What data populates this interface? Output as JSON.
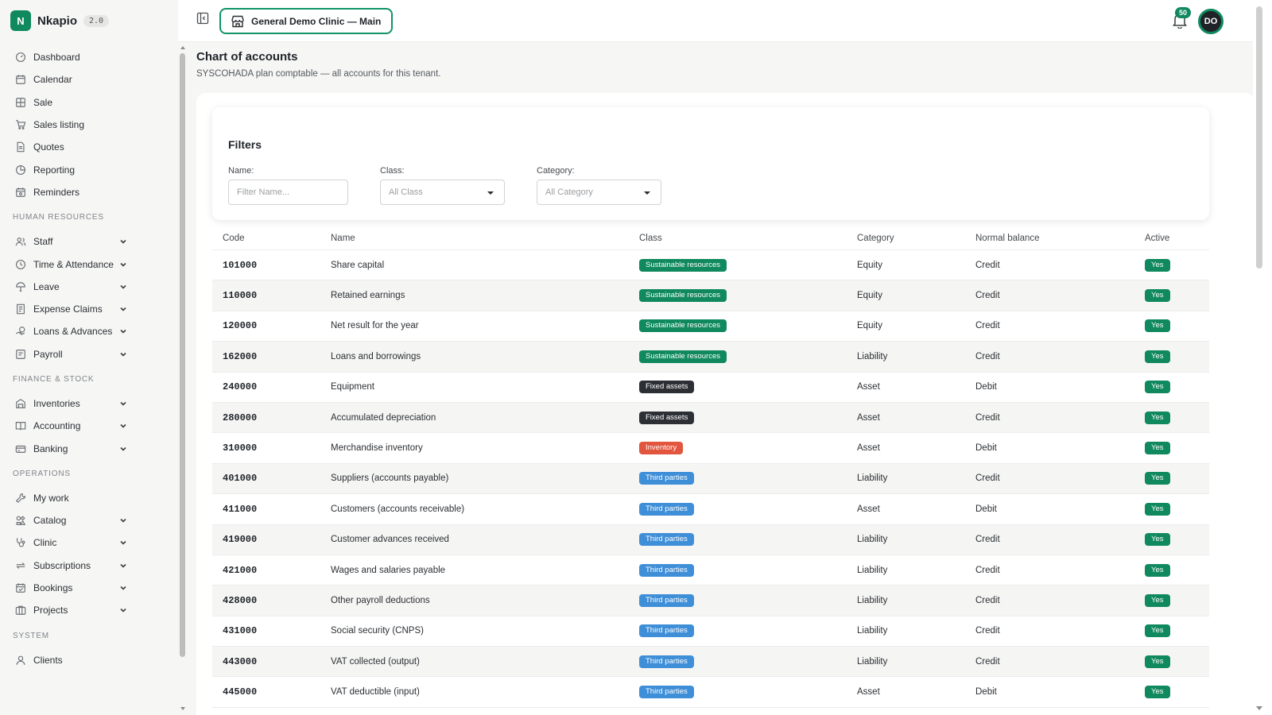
{
  "app": {
    "name": "Nkapio",
    "version": "2.0",
    "logo_letter": "N"
  },
  "topbar": {
    "clinic": "General Demo Clinic — Main",
    "notifications": "50",
    "avatar_initials": "DO"
  },
  "sidebar": {
    "main": [
      {
        "label": "Dashboard",
        "icon": "dashboard-icon"
      },
      {
        "label": "Calendar",
        "icon": "calendar-icon"
      },
      {
        "label": "Sale",
        "icon": "sale-icon"
      },
      {
        "label": "Sales listing",
        "icon": "cart-icon"
      },
      {
        "label": "Quotes",
        "icon": "quotes-icon"
      },
      {
        "label": "Reporting",
        "icon": "reporting-icon"
      },
      {
        "label": "Reminders",
        "icon": "reminders-icon"
      }
    ],
    "hr_title": "HUMAN RESOURCES",
    "hr": [
      {
        "label": "Staff",
        "icon": "staff-icon"
      },
      {
        "label": "Time & Attendance",
        "icon": "clock-icon"
      },
      {
        "label": "Leave",
        "icon": "leave-icon"
      },
      {
        "label": "Expense Claims",
        "icon": "expense-icon"
      },
      {
        "label": "Loans & Advances",
        "icon": "loans-icon"
      },
      {
        "label": "Payroll",
        "icon": "payroll-icon"
      }
    ],
    "finance_title": "FINANCE & STOCK",
    "finance": [
      {
        "label": "Inventories",
        "icon": "inventory-icon"
      },
      {
        "label": "Accounting",
        "icon": "book-icon"
      },
      {
        "label": "Banking",
        "icon": "bank-icon"
      }
    ],
    "ops_title": "OPERATIONS",
    "ops": [
      {
        "label": "My work",
        "icon": "wrench-icon"
      },
      {
        "label": "Catalog",
        "icon": "catalog-icon"
      },
      {
        "label": "Clinic",
        "icon": "stethoscope-icon"
      },
      {
        "label": "Subscriptions",
        "icon": "repeat-icon"
      },
      {
        "label": "Bookings",
        "icon": "bookings-icon"
      },
      {
        "label": "Projects",
        "icon": "projects-icon"
      }
    ],
    "system_title": "SYSTEM",
    "system": [
      {
        "label": "Clients",
        "icon": "user-icon"
      }
    ]
  },
  "page": {
    "title": "Chart of accounts",
    "subtitle": "SYSCOHADA plan comptable — all accounts for this tenant."
  },
  "filters": {
    "title": "Filters",
    "name_label": "Name:",
    "name_placeholder": "Filter Name...",
    "class_label": "Class:",
    "class_value": "All Class",
    "category_label": "Category:",
    "category_value": "All Category"
  },
  "table": {
    "columns": [
      "Code",
      "Name",
      "Class",
      "Category",
      "Normal balance",
      "Active"
    ],
    "rows": [
      {
        "code": "101000",
        "name": "Share capital",
        "class": "Sustainable resources",
        "class_color": "#10895f",
        "category": "Equity",
        "balance": "Credit",
        "active": "Yes"
      },
      {
        "code": "110000",
        "name": "Retained earnings",
        "class": "Sustainable resources",
        "class_color": "#10895f",
        "category": "Equity",
        "balance": "Credit",
        "active": "Yes"
      },
      {
        "code": "120000",
        "name": "Net result for the year",
        "class": "Sustainable resources",
        "class_color": "#10895f",
        "category": "Equity",
        "balance": "Credit",
        "active": "Yes"
      },
      {
        "code": "162000",
        "name": "Loans and borrowings",
        "class": "Sustainable resources",
        "class_color": "#10895f",
        "category": "Liability",
        "balance": "Credit",
        "active": "Yes"
      },
      {
        "code": "240000",
        "name": "Equipment",
        "class": "Fixed assets",
        "class_color": "#2c3035",
        "category": "Asset",
        "balance": "Debit",
        "active": "Yes"
      },
      {
        "code": "280000",
        "name": "Accumulated depreciation",
        "class": "Fixed assets",
        "class_color": "#2c3035",
        "category": "Asset",
        "balance": "Credit",
        "active": "Yes"
      },
      {
        "code": "310000",
        "name": "Merchandise inventory",
        "class": "Inventory",
        "class_color": "#e2553e",
        "category": "Asset",
        "balance": "Debit",
        "active": "Yes"
      },
      {
        "code": "401000",
        "name": "Suppliers (accounts payable)",
        "class": "Third parties",
        "class_color": "#3f8fd8",
        "category": "Liability",
        "balance": "Credit",
        "active": "Yes"
      },
      {
        "code": "411000",
        "name": "Customers (accounts receivable)",
        "class": "Third parties",
        "class_color": "#3f8fd8",
        "category": "Asset",
        "balance": "Debit",
        "active": "Yes"
      },
      {
        "code": "419000",
        "name": "Customer advances received",
        "class": "Third parties",
        "class_color": "#3f8fd8",
        "category": "Liability",
        "balance": "Credit",
        "active": "Yes"
      },
      {
        "code": "421000",
        "name": "Wages and salaries payable",
        "class": "Third parties",
        "class_color": "#3f8fd8",
        "category": "Liability",
        "balance": "Credit",
        "active": "Yes"
      },
      {
        "code": "428000",
        "name": "Other payroll deductions",
        "class": "Third parties",
        "class_color": "#3f8fd8",
        "category": "Liability",
        "balance": "Credit",
        "active": "Yes"
      },
      {
        "code": "431000",
        "name": "Social security (CNPS)",
        "class": "Third parties",
        "class_color": "#3f8fd8",
        "category": "Liability",
        "balance": "Credit",
        "active": "Yes"
      },
      {
        "code": "443000",
        "name": "VAT collected (output)",
        "class": "Third parties",
        "class_color": "#3f8fd8",
        "category": "Liability",
        "balance": "Credit",
        "active": "Yes"
      },
      {
        "code": "445000",
        "name": "VAT deductible (input)",
        "class": "Third parties",
        "class_color": "#3f8fd8",
        "category": "Asset",
        "balance": "Debit",
        "active": "Yes"
      }
    ]
  }
}
